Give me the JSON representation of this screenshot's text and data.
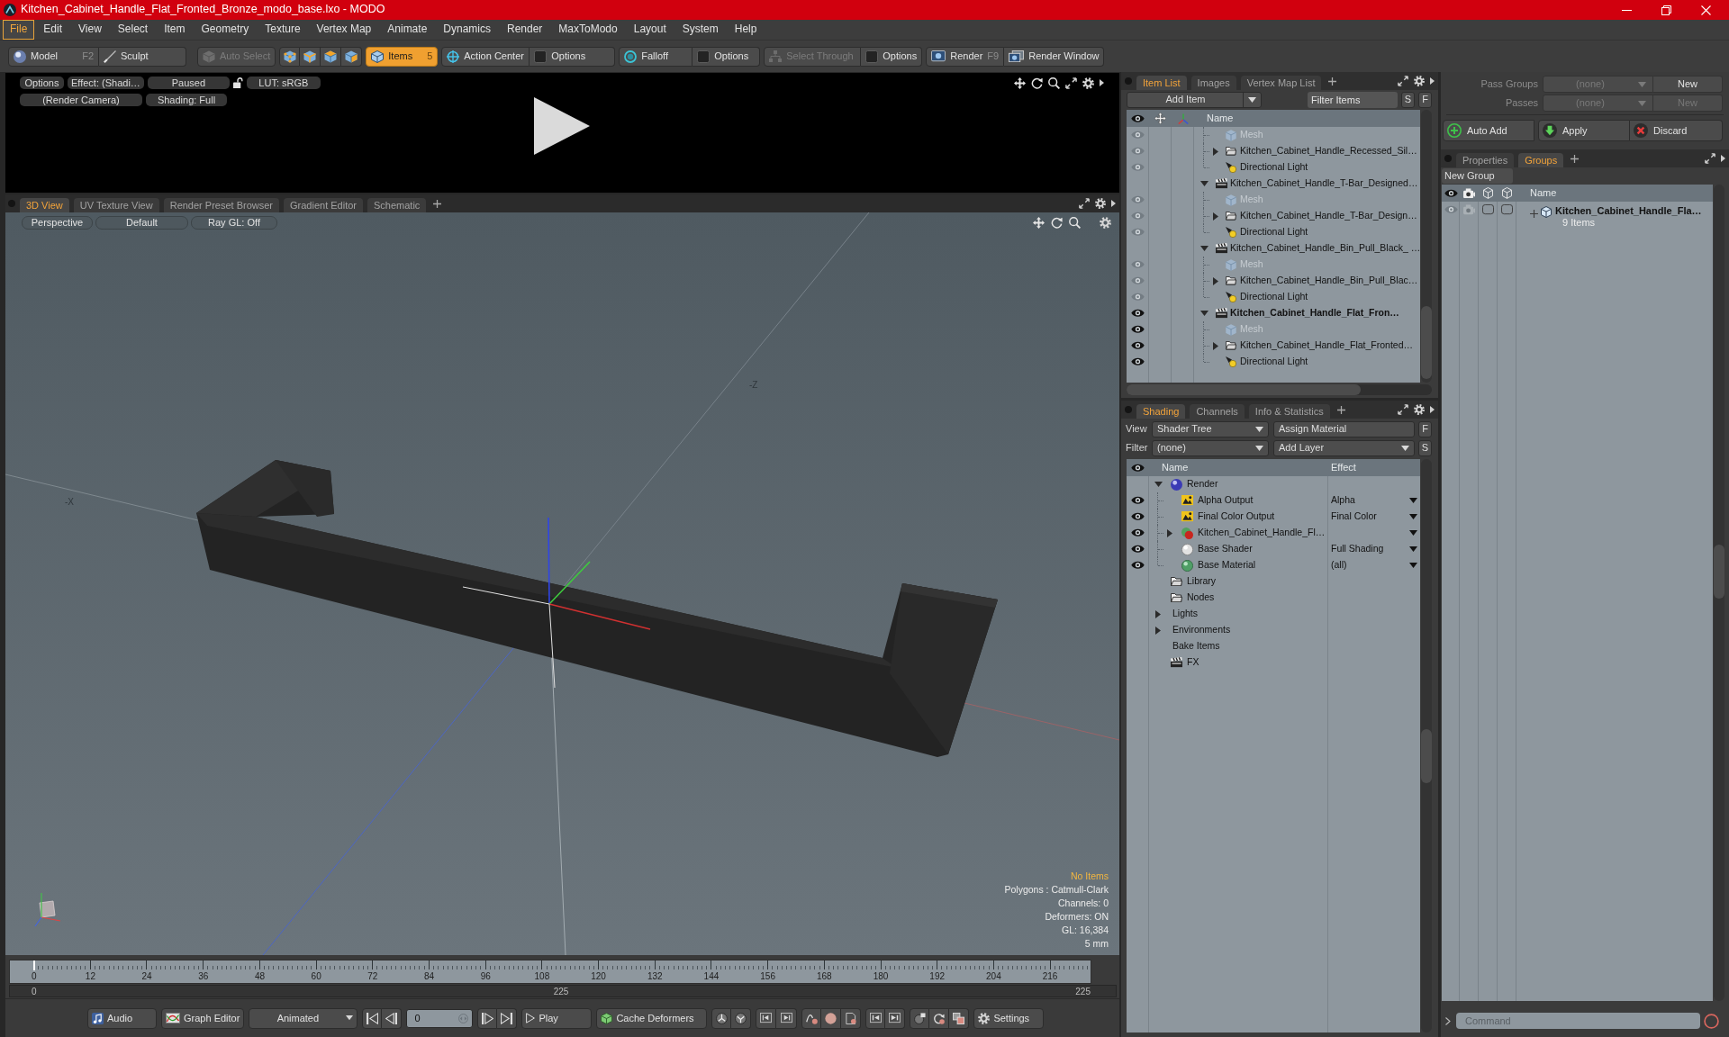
{
  "window": {
    "title": "Kitchen_Cabinet_Handle_Flat_Fronted_Bronze_modo_base.lxo - MODO"
  },
  "menu": [
    {
      "label": "File",
      "selected": true
    },
    {
      "label": "Edit",
      "selected": false
    },
    {
      "label": "View",
      "selected": false
    },
    {
      "label": "Select",
      "selected": false
    },
    {
      "label": "Item",
      "selected": false
    },
    {
      "label": "Geometry",
      "selected": false
    },
    {
      "label": "Texture",
      "selected": false
    },
    {
      "label": "Vertex Map",
      "selected": false
    },
    {
      "label": "Animate",
      "selected": false
    },
    {
      "label": "Dynamics",
      "selected": false
    },
    {
      "label": "Render",
      "selected": false
    },
    {
      "label": "MaxToModo",
      "selected": false
    },
    {
      "label": "Layout",
      "selected": false
    },
    {
      "label": "System",
      "selected": false
    },
    {
      "label": "Help",
      "selected": false
    }
  ],
  "toolbar": {
    "groups": [
      {
        "items": [
          {
            "label": "Model",
            "shortcut": "F2",
            "selected": false,
            "disabled": false
          },
          {
            "label": "Sculpt",
            "selected": false,
            "disabled": false
          }
        ]
      },
      {
        "items": [
          {
            "label": "Auto Select",
            "selected": false,
            "disabled": true
          }
        ]
      },
      {
        "items": [
          {
            "selected": false,
            "disabled": false
          },
          {
            "selected": false,
            "disabled": false
          },
          {
            "selected": false,
            "disabled": false
          },
          {
            "selected": false,
            "disabled": false
          }
        ]
      },
      {
        "items": [
          {
            "label": "Items",
            "shortcut": "5",
            "selected": true,
            "disabled": false
          }
        ]
      },
      {
        "items": [
          {
            "label": "Action Center",
            "selected": false,
            "disabled": false
          },
          {
            "label": "Options",
            "selected": false,
            "disabled": false
          }
        ]
      },
      {
        "items": [
          {
            "label": "Falloff",
            "selected": false,
            "disabled": false
          },
          {
            "label": "Options",
            "selected": false,
            "disabled": false
          }
        ]
      },
      {
        "items": [
          {
            "label": "Select Through",
            "selected": false,
            "disabled": true
          },
          {
            "label": "Options",
            "selected": false,
            "disabled": false
          }
        ]
      },
      {
        "items": [
          {
            "label": "Render",
            "shortcut": "F9",
            "selected": false,
            "disabled": false
          },
          {
            "label": "Render Window",
            "selected": false,
            "disabled": false
          }
        ]
      }
    ]
  },
  "render_preview": {
    "controls": [
      {
        "label": "Options"
      },
      {
        "label": "Effect: (Shadi…"
      },
      {
        "label": "Paused"
      },
      {
        "label": "LUT: sRGB"
      }
    ],
    "controls_row_2": [
      {
        "label": "(Render Camera)"
      },
      {
        "label": "Shading: Full"
      }
    ]
  },
  "viewport_tabs": [
    {
      "label": "3D View",
      "selected": true
    },
    {
      "label": "UV Texture View",
      "selected": false
    },
    {
      "label": "Render Preset Browser",
      "selected": false
    },
    {
      "label": "Gradient Editor",
      "selected": false
    },
    {
      "label": "Schematic",
      "selected": false
    }
  ],
  "viewport": {
    "controls": [
      {
        "label": "Perspective"
      },
      {
        "label": "Default"
      },
      {
        "label": "Ray GL: Off"
      }
    ],
    "axis_labels": [
      {
        "label": "-X"
      },
      {
        "label": "-Z"
      }
    ],
    "info": [
      {
        "text": "No Items",
        "kind": "notice"
      },
      {
        "text": "Polygons : Catmull-Clark",
        "kind": "stat"
      },
      {
        "text": "Channels: 0",
        "kind": "stat"
      },
      {
        "text": "Deformers: ON",
        "kind": "stat"
      },
      {
        "text": "GL: 16,384",
        "kind": "stat"
      },
      {
        "text": "5 mm",
        "kind": "stat"
      }
    ]
  },
  "timeline": {
    "ticks": [
      "0",
      "12",
      "24",
      "36",
      "48",
      "60",
      "72",
      "84",
      "96",
      "108",
      "120",
      "132",
      "144",
      "156",
      "168",
      "180",
      "192",
      "204",
      "216"
    ],
    "playhead": {
      "level": 0
    },
    "range_start": "0",
    "range_length": "225",
    "range_end": "225"
  },
  "transport": {
    "groups": [
      {
        "items": [
          {
            "kind": "button",
            "label": "Audio"
          }
        ]
      },
      {
        "items": [
          {
            "kind": "button",
            "label": "Graph Editor"
          }
        ]
      },
      {
        "items": [
          {
            "kind": "dropdown",
            "label": "Animated"
          }
        ]
      },
      {
        "items": [
          {
            "kind": "icon"
          },
          {
            "kind": "icon"
          }
        ]
      },
      {
        "items": [
          {
            "kind": "field",
            "value": "0"
          }
        ]
      },
      {
        "items": [
          {
            "kind": "icon"
          },
          {
            "kind": "icon"
          }
        ]
      },
      {
        "items": [
          {
            "kind": "button",
            "label": "Play"
          }
        ]
      },
      {
        "items": [
          {
            "kind": "button",
            "label": "Cache Deformers"
          }
        ]
      },
      {
        "items": [
          {
            "kind": "icon"
          },
          {
            "kind": "icon"
          }
        ]
      },
      {
        "items": [
          {
            "kind": "icon"
          },
          {
            "kind": "icon"
          }
        ]
      },
      {
        "items": [
          {
            "kind": "icon"
          },
          {
            "kind": "icon"
          },
          {
            "kind": "icon"
          }
        ]
      },
      {
        "items": [
          {
            "kind": "icon"
          },
          {
            "kind": "icon"
          }
        ]
      },
      {
        "items": [
          {
            "kind": "icon"
          },
          {
            "kind": "icon"
          },
          {
            "kind": "icon"
          }
        ]
      },
      {
        "items": [
          {
            "kind": "button",
            "label": "Settings"
          }
        ]
      }
    ]
  },
  "item_list": {
    "tabs": [
      {
        "label": "Item List",
        "selected": true
      },
      {
        "label": "Images",
        "selected": false
      },
      {
        "label": "Vertex Map List",
        "selected": false
      }
    ],
    "add_item": "Add Item",
    "filter": {
      "placeholder": "Filter Items"
    },
    "toggles": [
      "S",
      "F"
    ],
    "columns": [
      "Name"
    ],
    "tree": [
      {
        "children": [
          {
            "label": "Mesh",
            "kind": "mesh",
            "visible": false,
            "disabled": true
          },
          {
            "label": "Kitchen_Cabinet_Handle_Recessed_Sil…",
            "kind": "group",
            "visible": false,
            "disabled": false,
            "expanded": false
          },
          {
            "label": "Directional Light",
            "kind": "light",
            "visible": false,
            "disabled": false
          }
        ]
      },
      {
        "label": "Kitchen_Cabinet_Handle_T-Bar_Designed…",
        "kind": "scene",
        "visible": false,
        "active": false,
        "expanded": true,
        "children": [
          {
            "label": "Mesh",
            "kind": "mesh",
            "visible": false,
            "disabled": true
          },
          {
            "label": "Kitchen_Cabinet_Handle_T-Bar_Design…",
            "kind": "group",
            "visible": false,
            "disabled": false,
            "expanded": false
          },
          {
            "label": "Directional Light",
            "kind": "light",
            "visible": false,
            "disabled": false
          }
        ]
      },
      {
        "label": "Kitchen_Cabinet_Handle_Bin_Pull_Black_ …",
        "kind": "scene",
        "visible": false,
        "active": false,
        "expanded": true,
        "children": [
          {
            "label": "Mesh",
            "kind": "mesh",
            "visible": false,
            "disabled": true
          },
          {
            "label": "Kitchen_Cabinet_Handle_Bin_Pull_Blac…",
            "kind": "group",
            "visible": false,
            "disabled": false,
            "expanded": false
          },
          {
            "label": "Directional Light",
            "kind": "light",
            "visible": false,
            "disabled": false
          }
        ]
      },
      {
        "label": "Kitchen_Cabinet_Handle_Flat_Fron…",
        "kind": "scene",
        "visible": true,
        "active": true,
        "expanded": true,
        "children": [
          {
            "label": "Mesh",
            "kind": "mesh",
            "visible": true,
            "disabled": true
          },
          {
            "label": "Kitchen_Cabinet_Handle_Flat_Fronted…",
            "kind": "group",
            "visible": true,
            "disabled": false,
            "expanded": false
          },
          {
            "label": "Directional Light",
            "kind": "light",
            "visible": true,
            "disabled": false
          }
        ]
      }
    ]
  },
  "shading": {
    "tabs": [
      {
        "label": "Shading",
        "selected": true
      },
      {
        "label": "Channels",
        "selected": false
      },
      {
        "label": "Info & Statistics",
        "selected": false
      }
    ],
    "view": {
      "label": "View",
      "value": "Shader Tree",
      "button": "Assign Material",
      "toggle": "F"
    },
    "filter": {
      "label": "Filter",
      "value": "(none)",
      "menu": "Add Layer",
      "toggle": "S"
    },
    "columns": [
      "Name",
      "Effect"
    ],
    "tree": [
      {
        "label": "Render",
        "kind": "render",
        "expanded": true,
        "children": [
          {
            "label": "Alpha Output",
            "kind": "output",
            "visible": true,
            "effect": "Alpha"
          },
          {
            "label": "Final Color Output",
            "kind": "output",
            "visible": true,
            "effect": "Final Color"
          },
          {
            "label": "Kitchen_Cabinet_Handle_Fl…",
            "kind": "material_group",
            "visible": true,
            "expanded": false
          },
          {
            "label": "Base Shader",
            "kind": "shader",
            "visible": true,
            "effect": "Full Shading"
          },
          {
            "label": "Base Material",
            "kind": "material",
            "visible": true,
            "effect": "(all)"
          }
        ]
      },
      {
        "label": "Library",
        "kind": "folder"
      },
      {
        "label": "Nodes",
        "kind": "folder"
      },
      {
        "label": "Lights",
        "kind": "group",
        "expanded": false
      },
      {
        "label": "Environments",
        "kind": "group",
        "expanded": false
      },
      {
        "label": "Bake Items",
        "kind": "group"
      },
      {
        "label": "FX",
        "kind": "fx"
      }
    ]
  },
  "pass_groups": {
    "rows": [
      {
        "label": "Pass Groups",
        "value": "(none)",
        "button": "New",
        "disabled": false
      },
      {
        "label": "Passes",
        "value": "(none)",
        "button": "New",
        "disabled": true
      }
    ],
    "actions": [
      {
        "label": "Auto Add"
      },
      {
        "label": "Apply"
      },
      {
        "label": "Discard"
      }
    ]
  },
  "groups_panel": {
    "tabs": [
      {
        "label": "Properties",
        "selected": false
      },
      {
        "label": "Groups",
        "selected": true
      }
    ],
    "new_group": "New Group",
    "columns": [
      "Name"
    ],
    "rows": [
      {
        "label": "Kitchen_Cabinet_Handle_Fla…",
        "count": "9 Items",
        "expanded": false
      }
    ]
  },
  "command": {
    "placeholder": "Command"
  }
}
